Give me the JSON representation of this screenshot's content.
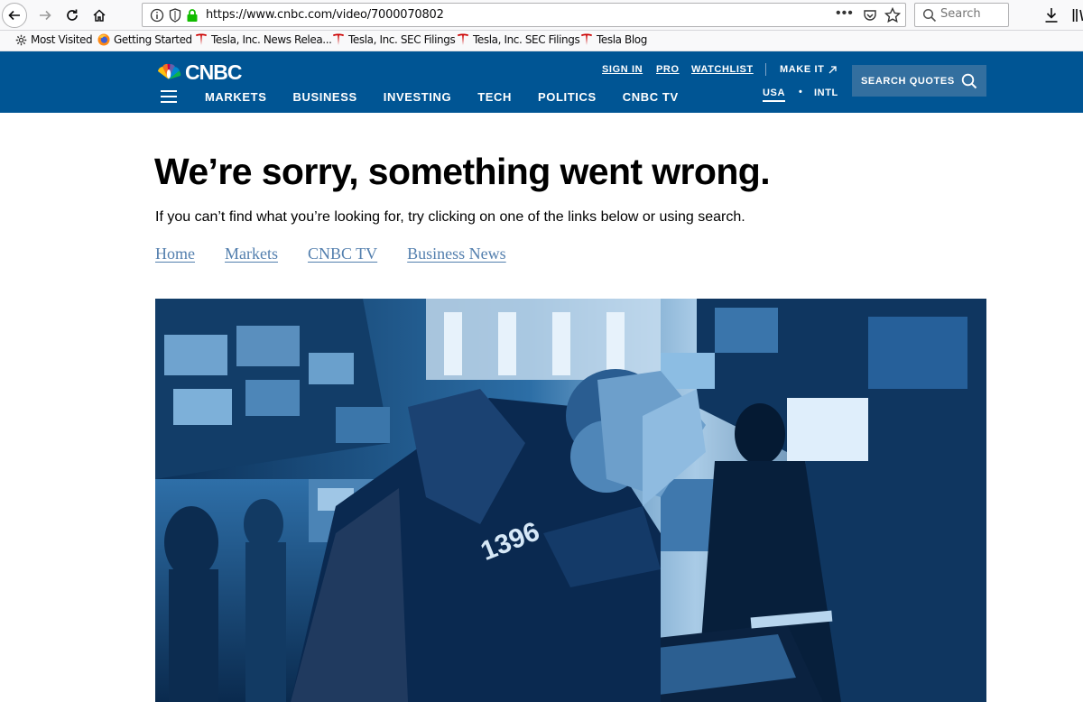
{
  "browser": {
    "url": "https://www.cnbc.com/video/7000070802",
    "search_placeholder": "Search",
    "page_actions_label": "•••",
    "bookmarks": [
      {
        "label": "Most Visited",
        "icon": "gear-icon"
      },
      {
        "label": "Getting Started",
        "icon": "firefox-icon"
      },
      {
        "label": "Tesla, Inc. News Relea...",
        "icon": "tesla-icon"
      },
      {
        "label": "Tesla, Inc. SEC Filings",
        "icon": "tesla-icon"
      },
      {
        "label": "Tesla, Inc. SEC Filings",
        "icon": "tesla-icon"
      },
      {
        "label": "Tesla Blog",
        "icon": "tesla-icon"
      }
    ]
  },
  "header": {
    "logo": "CNBC",
    "main_nav": [
      "MARKETS",
      "BUSINESS",
      "INVESTING",
      "TECH",
      "POLITICS",
      "CNBC TV"
    ],
    "util_nav": [
      "SIGN IN",
      "PRO",
      "WATCHLIST"
    ],
    "make_it": "MAKE IT",
    "region_usa": "USA",
    "region_sep": "•",
    "region_intl": "INTL",
    "search_quotes": "SEARCH QUOTES",
    "brand_color": "#005594"
  },
  "main": {
    "title": "We’re sorry, something went wrong.",
    "message": "If you can’t find what you’re looking for, try clicking on one of the links below or using search.",
    "links": [
      "Home",
      "Markets",
      "CNBC TV",
      "Business News"
    ],
    "hero_badge_number": "1396"
  }
}
